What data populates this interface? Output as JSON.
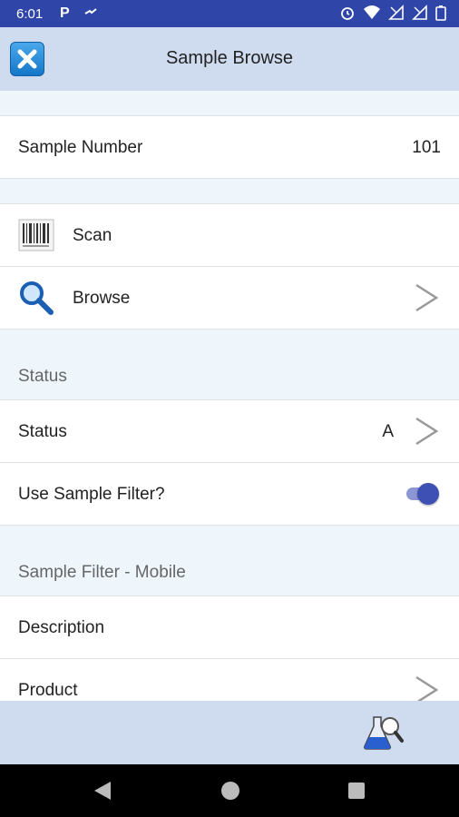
{
  "status_bar": {
    "time": "6:01",
    "p_label": "P"
  },
  "app_bar": {
    "title": "Sample Browse",
    "close_icon": "close-x-icon"
  },
  "sample_number": {
    "label": "Sample Number",
    "value": "101"
  },
  "actions": [
    {
      "label": "Scan",
      "icon": "barcode-icon"
    },
    {
      "label": "Browse",
      "icon": "magnifier-icon"
    }
  ],
  "status_section": {
    "title": "Status",
    "status_label": "Status",
    "status_value": "A",
    "filter_label": "Use Sample Filter?",
    "filter_enabled": true
  },
  "filter_section": {
    "title": "Sample Filter - Mobile",
    "description_label": "Description",
    "product_label": "Product"
  },
  "bottom_bar": {
    "action_icon": "flask-search-icon"
  },
  "colors": {
    "status_bar": "#2f45a8",
    "app_bar": "#cfdcf0",
    "section_bg": "#eef6fc",
    "toggle_on": "#3e50b4"
  }
}
